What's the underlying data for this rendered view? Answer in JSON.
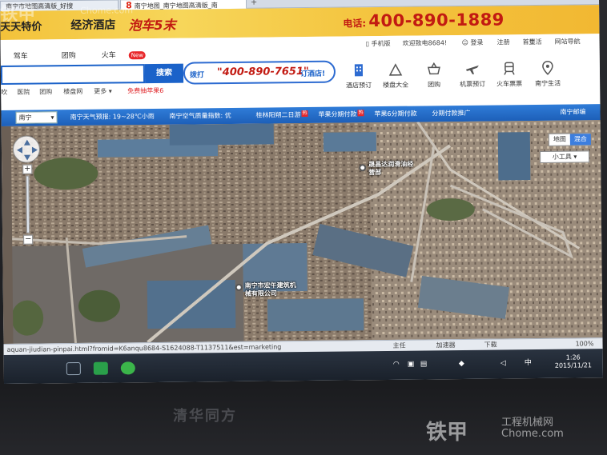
{
  "browser": {
    "tabs": [
      {
        "label": "南宁市地图高清版_好搜"
      },
      {
        "label": "南宁地图_南宁地图高清版_南",
        "num": "8"
      }
    ],
    "add_tab": "+"
  },
  "banner": {
    "left_a": "天天特价",
    "left_b": "经济酒店",
    "left_c": "泡车5末",
    "hotline_label": "电话:",
    "hotline_number": "400-890-1889"
  },
  "header": {
    "topnav": {
      "mobile": "手机版",
      "welcome": "欢迎致电8684!",
      "login": "登录",
      "register": "注册",
      "links": [
        "首页",
        "生活",
        "网站导航"
      ]
    },
    "search_tabs": [
      "驾车",
      "团购",
      "火车"
    ],
    "new_badge": "New",
    "search_button": "搜索",
    "promo": {
      "prefix": "拨打",
      "phone": "\"400-890-7651\"",
      "suffix": "订酒店!"
    },
    "quick_links": [
      "吹",
      "医院",
      "团购",
      "楼盘网",
      "更多 ▾"
    ],
    "quick_promo": "免费抽苹果6",
    "icon_nav": [
      {
        "label": "酒店预订",
        "icon": "hotel-icon"
      },
      {
        "label": "楼盘大全",
        "icon": "building-icon"
      },
      {
        "label": "团购",
        "icon": "basket-icon"
      },
      {
        "label": "机票预订",
        "icon": "plane-icon"
      },
      {
        "label": "火车票票",
        "icon": "train-icon"
      },
      {
        "label": "南宁生活",
        "icon": "location-pin-icon"
      }
    ]
  },
  "info_strip": {
    "city": "南宁",
    "weather": "南宁天气预报: 19~28℃小雨",
    "air": "南宁空气质量指数: 优",
    "trip": "桂林阳朔二日游",
    "apple1": "苹果分期付款",
    "apple2": "苹果6分期付款",
    "installment": "分期付款推广",
    "postal": "南宁邮编"
  },
  "map": {
    "mode_map": "地图",
    "mode_hybrid": "混合",
    "tools": "小工具 ▾",
    "labels": [
      {
        "text": "晟昌达润滑油经营部"
      },
      {
        "text": "南宁市宏午建筑机械有限公司"
      }
    ]
  },
  "statusbar": {
    "url": "aquan-jiudian-pinpai.html?fromid=K6anqu8684-S1624088-T1137511&est=marketing",
    "items": [
      "主任",
      "加速器",
      "下载"
    ],
    "zoom": "100%"
  },
  "taskbar": {
    "tray_text": "中",
    "time": "1:26",
    "date": "2015/11/21"
  },
  "bezel": {
    "brand": "清华同方",
    "watermark": "铁甲",
    "watermark_site": "工程机械网",
    "watermark_domain": "Chome.com"
  }
}
